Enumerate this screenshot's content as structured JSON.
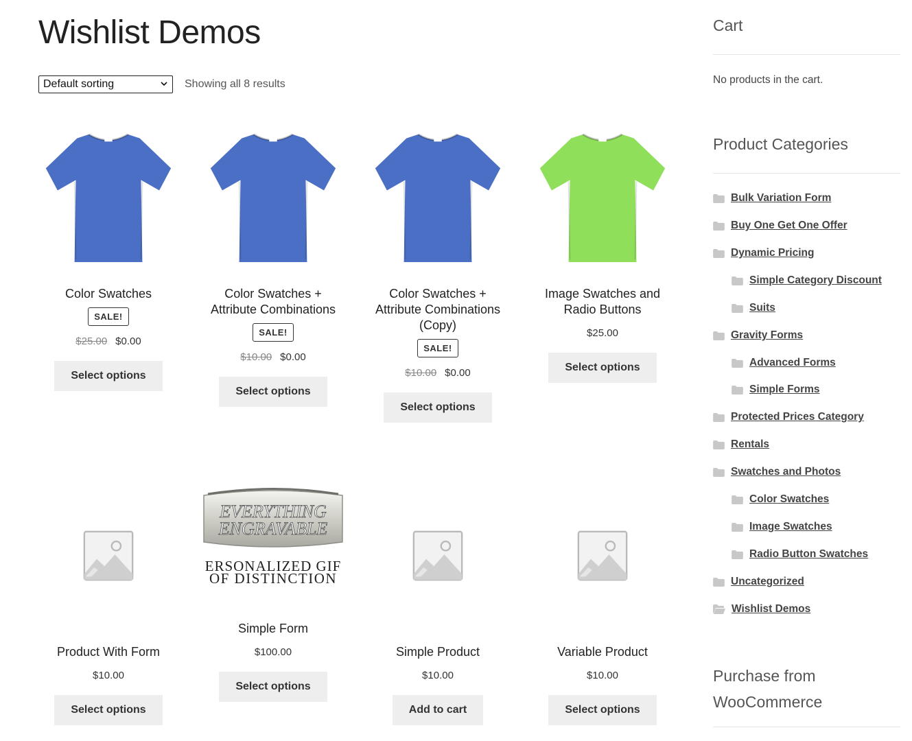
{
  "page": {
    "title": "Wishlist Demos"
  },
  "toolbar": {
    "sort_label": "Default sorting",
    "result_count": "Showing all 8 results"
  },
  "products": [
    {
      "name": "Color Swatches",
      "sale_badge": "SALE!",
      "old_price": "$25.00",
      "price": "$0.00",
      "button": "Select options",
      "image": "blue-tshirt"
    },
    {
      "name": "Color Swatches + Attribute Combinations",
      "sale_badge": "SALE!",
      "old_price": "$10.00",
      "price": "$0.00",
      "button": "Select options",
      "image": "blue-tshirt"
    },
    {
      "name": "Color Swatches + Attribute Combinations (Copy)",
      "sale_badge": "SALE!",
      "old_price": "$10.00",
      "price": "$0.00",
      "button": "Select options",
      "image": "blue-tshirt"
    },
    {
      "name": "Image Swatches and Radio Buttons",
      "price": "$25.00",
      "button": "Select options",
      "image": "green-tshirt"
    },
    {
      "name": "Product With Form",
      "price": "$10.00",
      "button": "Select options",
      "image": "placeholder"
    },
    {
      "name": "Simple Form",
      "price": "$100.00",
      "button": "Select options",
      "image": "engraving-logo",
      "image_text": {
        "line1": "EVERYTHING",
        "line2": "ENGRAVABLE",
        "line3": "ERSONALIZED GIF",
        "line4": "OF DISTINCTION"
      }
    },
    {
      "name": "Simple Product",
      "price": "$10.00",
      "button": "Add to cart",
      "image": "placeholder"
    },
    {
      "name": "Variable Product",
      "price": "$10.00",
      "button": "Select options",
      "image": "placeholder"
    }
  ],
  "sidebar": {
    "cart": {
      "title": "Cart",
      "empty_text": "No products in the cart."
    },
    "categories": {
      "title": "Product Categories",
      "items": [
        {
          "label": "Bulk Variation Form",
          "icon": "folder-icon"
        },
        {
          "label": "Buy One Get One Offer",
          "icon": "folder-icon"
        },
        {
          "label": "Dynamic Pricing",
          "icon": "folder-icon"
        },
        {
          "label": "Simple Category Discount",
          "icon": "folder-icon"
        },
        {
          "label": "Suits",
          "icon": "folder-icon"
        },
        {
          "label": "Gravity Forms",
          "icon": "folder-icon"
        },
        {
          "label": "Advanced Forms",
          "icon": "folder-icon"
        },
        {
          "label": "Simple Forms",
          "icon": "folder-icon"
        },
        {
          "label": "Protected Prices Category",
          "icon": "folder-icon"
        },
        {
          "label": "Rentals",
          "icon": "folder-icon"
        },
        {
          "label": "Swatches and Photos",
          "icon": "folder-icon"
        },
        {
          "label": "Color Swatches",
          "icon": "folder-icon"
        },
        {
          "label": "Image Swatches",
          "icon": "folder-icon"
        },
        {
          "label": "Radio Button Swatches",
          "icon": "folder-icon"
        },
        {
          "label": "Uncategorized",
          "icon": "folder-icon"
        },
        {
          "label": "Wishlist Demos",
          "icon": "folder-open-icon"
        }
      ]
    },
    "purchase": {
      "title_line1": "Purchase from",
      "title_line2": "WooCommerce"
    }
  },
  "colors": {
    "tshirt_blue": "#4b6fc4",
    "tshirt_green": "#8fdf5a",
    "button_bg": "#eeeeee",
    "folder_gray": "#c8c8c8"
  }
}
